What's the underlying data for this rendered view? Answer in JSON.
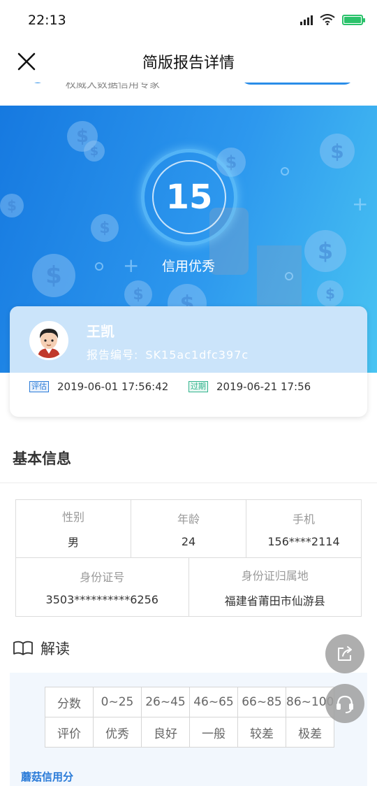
{
  "status_bar": {
    "time": "22:13"
  },
  "nav": {
    "title": "简版报告详情"
  },
  "peek": {
    "text": "权威大数据信用专家"
  },
  "hero": {
    "score": "15",
    "score_label": "信用优秀"
  },
  "card": {
    "name": "王凯",
    "report_label": "报告编号:",
    "report_no": "SK15ac1dfc397c",
    "eval_tag": "评估",
    "eval_date": "2019-06-01 17:56:42",
    "expire_tag": "过期",
    "expire_date": "2019-06-21 17:56"
  },
  "basic": {
    "title": "基本信息",
    "gender_label": "性别",
    "gender": "男",
    "age_label": "年龄",
    "age": "24",
    "phone_label": "手机",
    "phone": "156****2114",
    "id_label": "身份证号",
    "id": "3503**********6256",
    "place_label": "身份证归属地",
    "place": "福建省莆田市仙游县"
  },
  "interpret": {
    "title": "解读",
    "row1": [
      "分数",
      "0~25",
      "26~45",
      "46~65",
      "66~85",
      "86~100"
    ],
    "row2": [
      "评价",
      "优秀",
      "良好",
      "一般",
      "较差",
      "极差"
    ],
    "footer": "蘑菇信用分"
  },
  "icons": [
    "close-icon",
    "signal-icon",
    "wifi-icon",
    "battery-icon",
    "book-icon",
    "share-icon",
    "headset-icon"
  ],
  "colors": {
    "brand_blue": "#1c86e6",
    "battery_green": "#2bc26b",
    "expire_green": "#33b48e"
  }
}
